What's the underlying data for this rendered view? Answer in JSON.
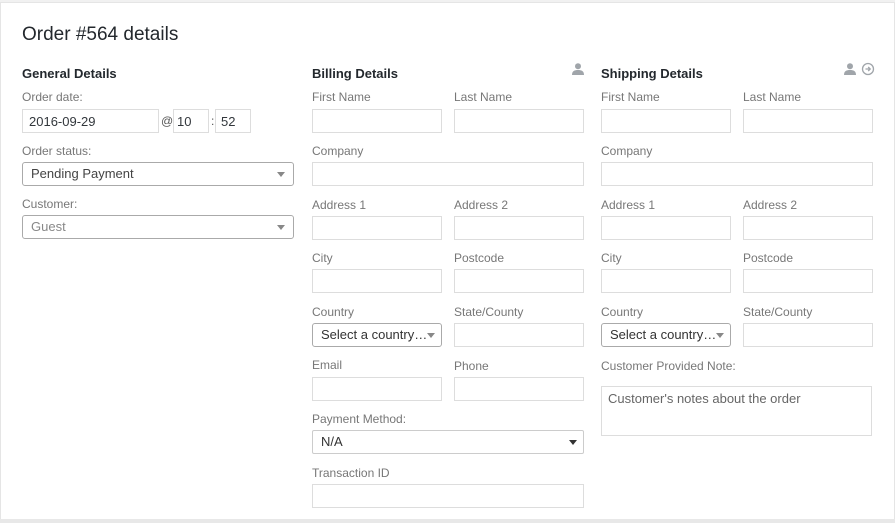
{
  "title": "Order #564 details",
  "general": {
    "heading": "General Details",
    "order_date_label": "Order date:",
    "date_value": "2016-09-29",
    "at": "@",
    "hour_value": "10",
    "colon": ":",
    "minute_value": "52",
    "status_label": "Order status:",
    "status_value": "Pending Payment",
    "customer_label": "Customer:",
    "customer_value": "Guest"
  },
  "billing": {
    "heading": "Billing Details",
    "edit_icon": "user-icon",
    "first_name_label": "First Name",
    "last_name_label": "Last Name",
    "company_label": "Company",
    "address1_label": "Address 1",
    "address2_label": "Address 2",
    "city_label": "City",
    "postcode_label": "Postcode",
    "country_label": "Country",
    "country_value": "Select a country…",
    "state_label": "State/County",
    "email_label": "Email",
    "phone_label": "Phone",
    "payment_method_label": "Payment Method:",
    "payment_method_value": "N/A",
    "transaction_id_label": "Transaction ID"
  },
  "shipping": {
    "heading": "Shipping Details",
    "edit_icon": "user-icon",
    "copy_icon": "load-billing-icon",
    "first_name_label": "First Name",
    "last_name_label": "Last Name",
    "company_label": "Company",
    "address1_label": "Address 1",
    "address2_label": "Address 2",
    "city_label": "City",
    "postcode_label": "Postcode",
    "country_label": "Country",
    "country_value": "Select a country…",
    "state_label": "State/County",
    "note_label": "Customer Provided Note:",
    "note_placeholder": "Customer's notes about the order"
  }
}
